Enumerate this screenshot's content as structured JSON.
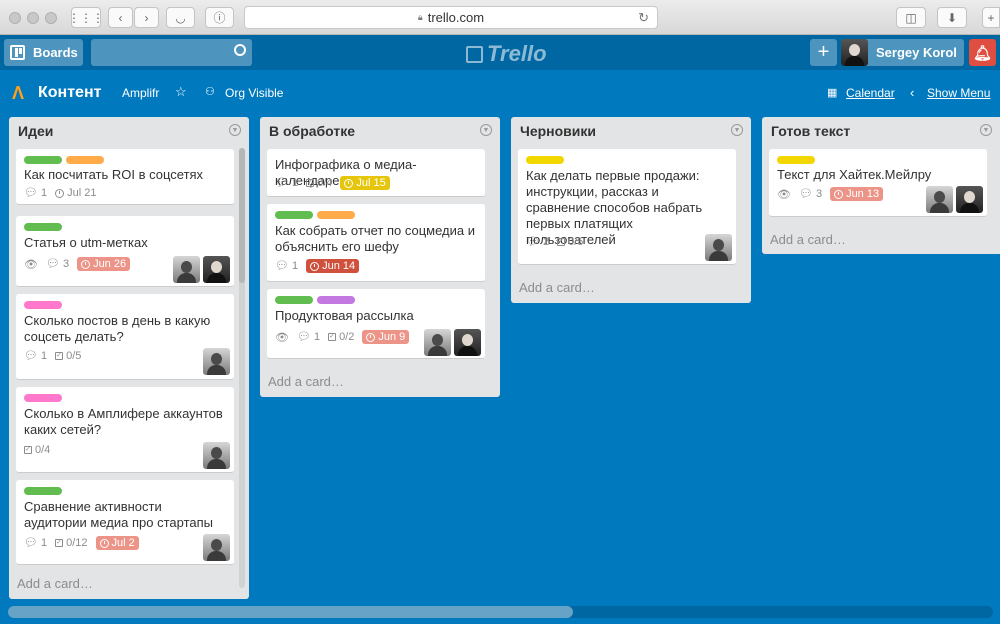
{
  "browser": {
    "url": "trello.com"
  },
  "header": {
    "boards_label": "Boards",
    "search_placeholder": "",
    "logo": "Trello",
    "user_name": "Sergey Korol",
    "add_label": "+"
  },
  "board": {
    "title": "Контент",
    "team": "Amplifr",
    "visibility": "Org Visible",
    "calendar": "Calendar",
    "show_menu": "Show Menu"
  },
  "colors": {
    "green": "#61bd4f",
    "orange": "#ffab4a",
    "yellow": "#f2d600",
    "pink": "#ff78cb",
    "purple": "#c377e0",
    "red_due": "#ec9488",
    "overdue": "#cf513d",
    "yellow_due": "#e6c60d",
    "bg": "#0079bf"
  },
  "lists": [
    {
      "title": "Идеи",
      "add": "Add a card…",
      "cards": [
        {
          "title": "Как посчитать ROI в соцсетях",
          "comments": "1",
          "due": "Jul 21"
        },
        {
          "title": "Статья о utm-метках",
          "comments": "3",
          "due": "Jun 26"
        },
        {
          "title": "Сколько постов в день в какую соцсеть делать?",
          "comments": "1",
          "checklist": "0/5"
        },
        {
          "title": "Сколько в Амплифере аккаунтов каких сетей?",
          "checklist": "0/4"
        },
        {
          "title": "Сравнение активности аудитории медиа про стартапы",
          "comments": "1",
          "checklist": "0/12",
          "due": "Jul 2"
        }
      ]
    },
    {
      "title": "В обработке",
      "add": "Add a card…",
      "cards": [
        {
          "title": "Инфографика о медиа-календаре",
          "comments": "1",
          "checklist": "0/4",
          "due": "Jul 15"
        },
        {
          "title": "Как собрать отчет по соцмедиа и объяснить его шефу",
          "comments": "1",
          "due": "Jun 14"
        },
        {
          "title": "Продуктовая рассылка",
          "comments": "1",
          "checklist": "0/2",
          "due": "Jun 9"
        }
      ]
    },
    {
      "title": "Черновики",
      "add": "Add a card…",
      "cards": [
        {
          "title": "Как делать первые продажи: инструкции, рассказ и сравнение способов набрать первых платящих пользователей",
          "comments": "2",
          "checklist": "0/5"
        }
      ]
    },
    {
      "title": "Готов текст",
      "add": "Add a card…",
      "cards": [
        {
          "title": "Текст для Хайтек.Мейлру",
          "comments": "3",
          "due": "Jun 13"
        }
      ]
    }
  ]
}
